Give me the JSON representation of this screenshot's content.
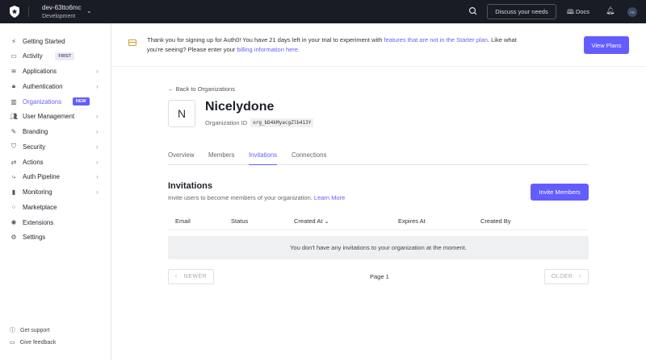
{
  "topbar": {
    "tenant": "dev-63tto6mc",
    "environment": "Development",
    "discuss": "Discuss your needs",
    "docs": "Docs",
    "avatar": "PR"
  },
  "sidebar": {
    "items": [
      {
        "label": "Getting Started",
        "icon": "bolt-icon"
      },
      {
        "label": "Activity",
        "icon": "activity-icon",
        "badge": "FIRST"
      },
      {
        "label": "Applications",
        "icon": "stack-icon",
        "arrow": true
      },
      {
        "label": "Authentication",
        "icon": "lock-icon",
        "arrow": true
      },
      {
        "label": "Organizations",
        "icon": "buildings-icon",
        "badge": "NEW",
        "active": true
      },
      {
        "label": "User Management",
        "icon": "users-icon",
        "arrow": true
      },
      {
        "label": "Branding",
        "icon": "brush-icon",
        "arrow": true
      },
      {
        "label": "Security",
        "icon": "shield-icon",
        "arrow": true
      },
      {
        "label": "Actions",
        "icon": "actions-icon",
        "arrow": true
      },
      {
        "label": "Auth Pipeline",
        "icon": "pipeline-icon",
        "arrow": true
      },
      {
        "label": "Monitoring",
        "icon": "bar-chart-icon",
        "arrow": true
      },
      {
        "label": "Marketplace",
        "icon": "grid-icon"
      },
      {
        "label": "Extensions",
        "icon": "extension-icon"
      },
      {
        "label": "Settings",
        "icon": "gear-icon"
      }
    ],
    "footer": {
      "support": "Get support",
      "feedback": "Give feedback"
    }
  },
  "banner": {
    "text1": "Thank you for signing up for Auth0! You have 21 days left in your trial to experiment with ",
    "link1": "features that are not in the Starter plan",
    "text2": ". Like what you're seeing? Please enter your ",
    "link2": "billing information here",
    "text3": ".",
    "button": "View Plans"
  },
  "org": {
    "back": "Back to Organizations",
    "initial": "N",
    "name": "Nicelydone",
    "id_label": "Organization ID",
    "id": "org_bD4kMyacgZlb413Y"
  },
  "tabs": [
    "Overview",
    "Members",
    "Invitations",
    "Connections"
  ],
  "invitations": {
    "title": "Invitations",
    "subtitle": "Invite users to become members of your organization. ",
    "learn_more": "Learn More",
    "invite_button": "Invite Members",
    "columns": [
      "Email",
      "Status",
      "Created At",
      "Expires At",
      "Created By"
    ],
    "empty": "You don't have any invitations to your organization at the moment.",
    "newer": "NEWER",
    "older": "OLDER",
    "page": "Page 1"
  }
}
